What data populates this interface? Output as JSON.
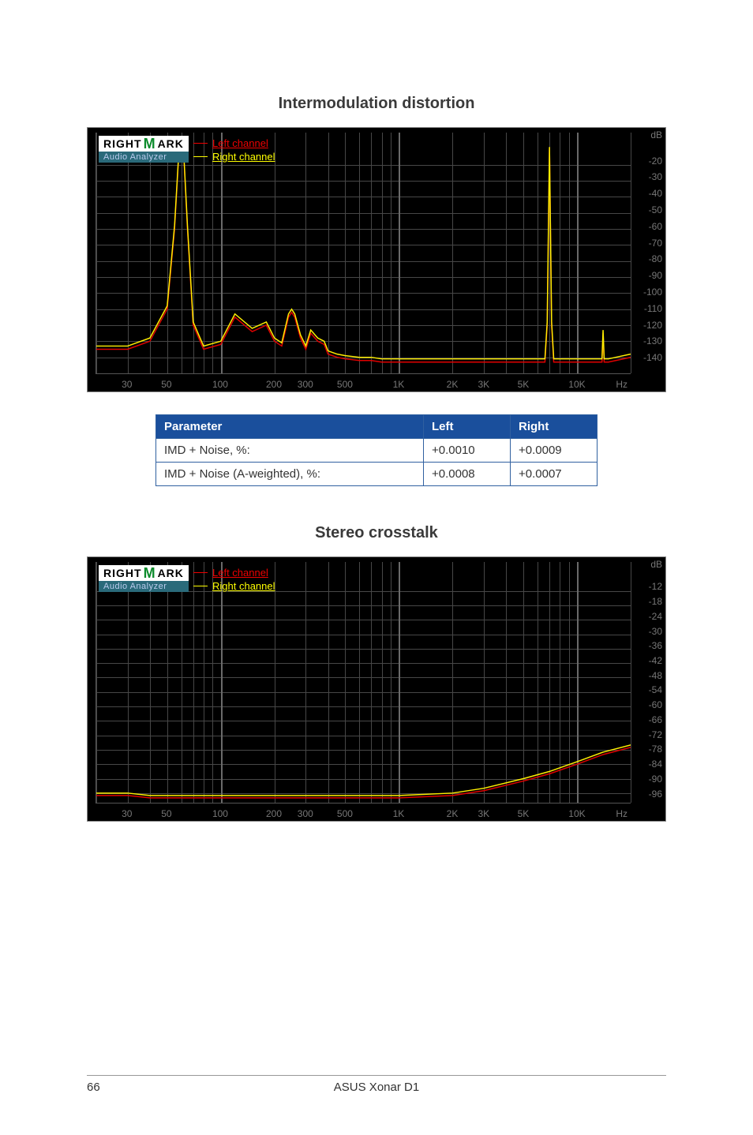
{
  "sections": {
    "imd": {
      "title": "Intermodulation distortion"
    },
    "xtalk": {
      "title": "Stereo crosstalk"
    }
  },
  "logo": {
    "top_left": "RIGHT",
    "top_m": "M",
    "top_right": "ARK",
    "bottom": "Audio Analyzer"
  },
  "legend": {
    "left_label": "Left channel",
    "right_label": "Right channel"
  },
  "axis": {
    "y_unit": "dB",
    "x_unit": "Hz"
  },
  "param_table": {
    "headers": {
      "parameter": "Parameter",
      "left": "Left",
      "right": "Right"
    },
    "rows": [
      {
        "param": "IMD + Noise, %:",
        "left": "+0.0010",
        "right": "+0.0009"
      },
      {
        "param": "IMD + Noise (A-weighted), %:",
        "left": "+0.0008",
        "right": "+0.0007"
      }
    ]
  },
  "footer": {
    "page": "66",
    "title": "ASUS Xonar D1"
  },
  "chart_data": [
    {
      "type": "line",
      "title": "Intermodulation distortion",
      "xlabel": "Hz",
      "ylabel": "dB",
      "xscale": "log",
      "xlim": [
        20,
        20000
      ],
      "ylim": [
        -150,
        0
      ],
      "y_ticks": [
        -20,
        -30,
        -40,
        -50,
        -60,
        -70,
        -80,
        -90,
        -100,
        -110,
        -120,
        -130,
        -140
      ],
      "x_ticks": [
        30,
        50,
        100,
        200,
        300,
        500,
        1000,
        2000,
        3000,
        5000,
        10000
      ],
      "x_tick_labels": [
        "30",
        "50",
        "100",
        "200",
        "300",
        "500",
        "1K",
        "2K",
        "3K",
        "5K",
        "10K"
      ],
      "series": [
        {
          "name": "Left channel",
          "color": "#e00000",
          "x": [
            20,
            30,
            40,
            50,
            55,
            58,
            60,
            62,
            65,
            70,
            80,
            100,
            120,
            150,
            180,
            200,
            220,
            240,
            250,
            260,
            280,
            300,
            320,
            350,
            380,
            400,
            450,
            500,
            600,
            700,
            800,
            900,
            1000,
            1200,
            1500,
            2000,
            3000,
            5000,
            6600,
            6800,
            7000,
            7200,
            7400,
            8000,
            10000,
            13800,
            14000,
            14200,
            15000,
            20000
          ],
          "y": [
            -135,
            -135,
            -130,
            -110,
            -60,
            -15,
            -10,
            -15,
            -60,
            -120,
            -135,
            -132,
            -115,
            -124,
            -120,
            -130,
            -133,
            -115,
            -112,
            -115,
            -128,
            -135,
            -125,
            -130,
            -132,
            -138,
            -140,
            -141,
            -142,
            -142,
            -143,
            -143,
            -143,
            -143,
            -143,
            -143,
            -143,
            -143,
            -143,
            -120,
            -10,
            -120,
            -143,
            -143,
            -143,
            -143,
            -125,
            -143,
            -143,
            -140
          ]
        },
        {
          "name": "Right channel",
          "color": "#ffee00",
          "x": [
            20,
            30,
            40,
            50,
            55,
            58,
            60,
            62,
            65,
            70,
            80,
            100,
            120,
            150,
            180,
            200,
            220,
            240,
            250,
            260,
            280,
            300,
            320,
            350,
            380,
            400,
            450,
            500,
            600,
            700,
            800,
            900,
            1000,
            1200,
            1500,
            2000,
            3000,
            5000,
            6600,
            6800,
            7000,
            7200,
            7400,
            8000,
            10000,
            13800,
            14000,
            14200,
            15000,
            20000
          ],
          "y": [
            -133,
            -133,
            -128,
            -108,
            -58,
            -14,
            -9,
            -14,
            -58,
            -118,
            -133,
            -130,
            -113,
            -122,
            -118,
            -128,
            -131,
            -113,
            -110,
            -113,
            -126,
            -133,
            -123,
            -128,
            -130,
            -136,
            -138,
            -139,
            -140,
            -140,
            -141,
            -141,
            -141,
            -141,
            -141,
            -141,
            -141,
            -141,
            -141,
            -118,
            -9,
            -118,
            -141,
            -141,
            -141,
            -141,
            -123,
            -141,
            -141,
            -138
          ]
        }
      ]
    },
    {
      "type": "line",
      "title": "Stereo crosstalk",
      "xlabel": "Hz",
      "ylabel": "dB",
      "xscale": "log",
      "xlim": [
        20,
        20000
      ],
      "ylim": [
        -100,
        0
      ],
      "y_ticks": [
        -12,
        -18,
        -24,
        -30,
        -36,
        -42,
        -48,
        -54,
        -60,
        -66,
        -72,
        -78,
        -84,
        -90,
        -96
      ],
      "x_ticks": [
        30,
        50,
        100,
        200,
        300,
        500,
        1000,
        2000,
        3000,
        5000,
        10000
      ],
      "x_tick_labels": [
        "30",
        "50",
        "100",
        "200",
        "300",
        "500",
        "1K",
        "2K",
        "3K",
        "5K",
        "10K"
      ],
      "series": [
        {
          "name": "Left channel",
          "color": "#e00000",
          "x": [
            20,
            30,
            40,
            50,
            70,
            100,
            200,
            500,
            1000,
            2000,
            3000,
            5000,
            7000,
            10000,
            14000,
            20000
          ],
          "y": [
            -97,
            -97,
            -98,
            -98,
            -98,
            -98,
            -98,
            -98,
            -98,
            -97,
            -95,
            -91,
            -88,
            -84,
            -80,
            -77
          ]
        },
        {
          "name": "Right channel",
          "color": "#ffee00",
          "x": [
            20,
            30,
            40,
            50,
            70,
            100,
            200,
            500,
            1000,
            2000,
            3000,
            5000,
            7000,
            10000,
            14000,
            20000
          ],
          "y": [
            -96,
            -96,
            -97,
            -97,
            -97,
            -97,
            -97,
            -97,
            -97,
            -96,
            -94,
            -90,
            -87,
            -83,
            -79,
            -76
          ]
        }
      ]
    }
  ]
}
